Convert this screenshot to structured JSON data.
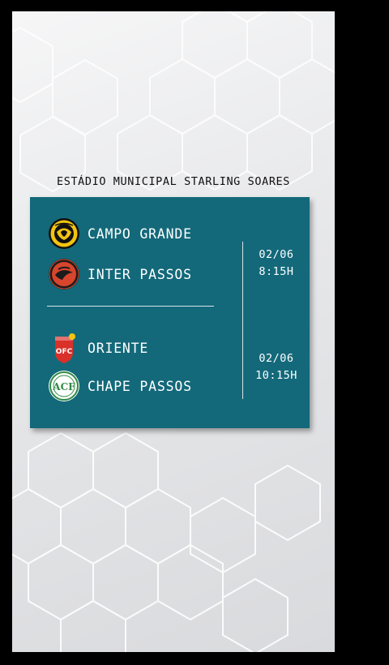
{
  "venue": "ESTÁDIO MUNICIPAL STARLING SOARES",
  "matches": [
    {
      "home": {
        "name": "CAMPO GRANDE",
        "crest": "campo-grande-crest"
      },
      "away": {
        "name": "INTER PASSOS",
        "crest": "inter-passos-crest"
      },
      "date": "02/06",
      "time": "8:15H"
    },
    {
      "home": {
        "name": "ORIENTE",
        "crest": "oriente-crest",
        "crest_text": "OFC"
      },
      "away": {
        "name": "CHAPE PASSOS",
        "crest": "chape-passos-crest",
        "crest_text": "ACF"
      },
      "date": "02/06",
      "time": "10:15H"
    }
  ],
  "colors": {
    "card": "#13697a",
    "campo_grande_yellow": "#f2c40f",
    "inter_passos_red": "#d6452c",
    "oriente_red": "#d9302a",
    "chape_green": "#2f8a45"
  }
}
